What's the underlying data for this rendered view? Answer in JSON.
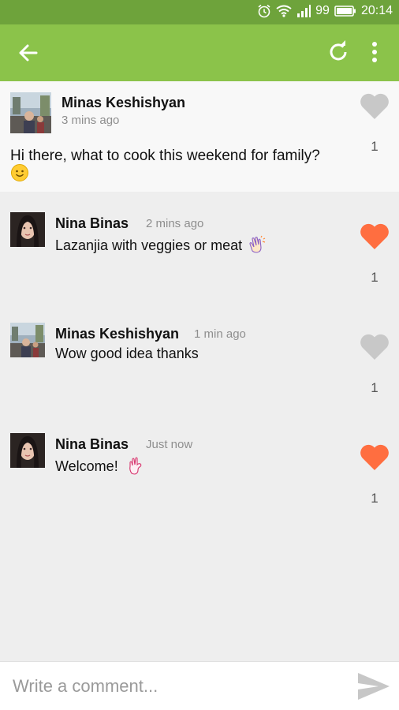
{
  "status_bar": {
    "battery": "99",
    "time": "20:14"
  },
  "app_bar": {
    "back_icon": "arrow-left-icon",
    "refresh_icon": "refresh-icon",
    "more_icon": "more-vert-icon"
  },
  "post": {
    "author": "Minas Keshishyan",
    "time": "3 mins ago",
    "text": "Hi there, what to cook this weekend for family?",
    "emoji": "smile-emoji",
    "likes": "1",
    "liked": false
  },
  "comments": [
    {
      "author": "Nina Binas",
      "time": "2 mins ago",
      "text": "Lazanjia with veggies or meat",
      "emoji": "clap-emoji",
      "likes": "1",
      "liked": true
    },
    {
      "author": "Minas Keshishyan",
      "time": "1 min ago",
      "text": "Wow good idea thanks",
      "emoji": "",
      "likes": "1",
      "liked": false
    },
    {
      "author": "Nina Binas",
      "time": "Just now",
      "text": "Welcome!",
      "emoji": "ok-hand-emoji",
      "likes": "1",
      "liked": true
    }
  ],
  "composer": {
    "placeholder": "Write a comment..."
  },
  "colors": {
    "accent": "#8bc34a",
    "status_bar": "#6ea33b",
    "liked": "#ff6e40",
    "unliked": "#c8c8c8"
  }
}
